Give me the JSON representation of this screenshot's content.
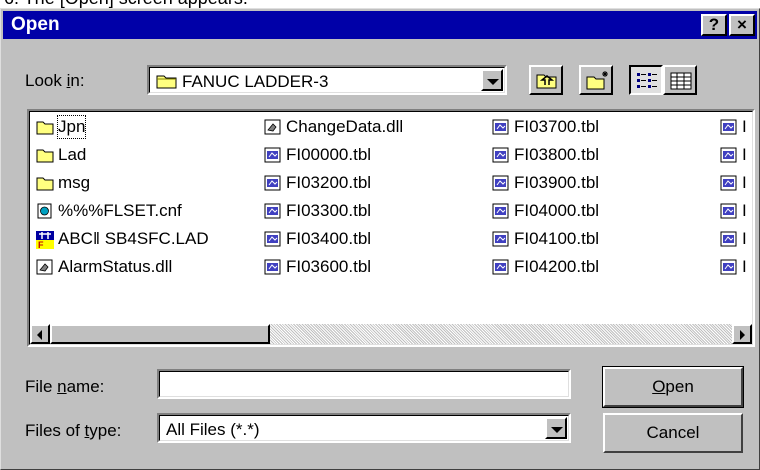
{
  "caption": "6. The [Open] screen appears.",
  "window": {
    "title": "Open",
    "help_glyph": "?",
    "close_glyph": "×"
  },
  "look_in": {
    "label_prefix": "Look ",
    "label_mnemonic": "i",
    "label_suffix": "n:",
    "value": "FANUC LADDER-3"
  },
  "toolbar": {
    "buttons": [
      {
        "name": "up-one-level",
        "icon": "up-folder-icon"
      },
      {
        "name": "create-new-folder",
        "icon": "new-folder-icon"
      },
      {
        "name": "list-view",
        "icon": "list-view-icon",
        "pressed": true
      },
      {
        "name": "details-view",
        "icon": "details-view-icon"
      }
    ]
  },
  "files": {
    "col1": [
      {
        "name": "Jpn",
        "type": "folder"
      },
      {
        "name": "Lad",
        "type": "folder"
      },
      {
        "name": "msg",
        "type": "folder"
      },
      {
        "name": "%%%FLSET.cnf",
        "type": "cnf"
      },
      {
        "name": "ABC‖ SB4SFC.LAD",
        "type": "lad"
      },
      {
        "name": "AlarmStatus.dll",
        "type": "dll"
      }
    ],
    "col2": [
      {
        "name": "ChangeData.dll",
        "type": "dll"
      },
      {
        "name": "FI00000.tbl",
        "type": "tbl"
      },
      {
        "name": "FI03200.tbl",
        "type": "tbl"
      },
      {
        "name": "FI03300.tbl",
        "type": "tbl"
      },
      {
        "name": "FI03400.tbl",
        "type": "tbl"
      },
      {
        "name": "FI03600.tbl",
        "type": "tbl"
      }
    ],
    "col3": [
      {
        "name": "FI03700.tbl",
        "type": "tbl"
      },
      {
        "name": "FI03800.tbl",
        "type": "tbl"
      },
      {
        "name": "FI03900.tbl",
        "type": "tbl"
      },
      {
        "name": "FI04000.tbl",
        "type": "tbl"
      },
      {
        "name": "FI04100.tbl",
        "type": "tbl"
      },
      {
        "name": "FI04200.tbl",
        "type": "tbl"
      }
    ],
    "col4": [
      {
        "name": "I",
        "type": "tbl"
      },
      {
        "name": "I",
        "type": "tbl"
      },
      {
        "name": "I",
        "type": "tbl"
      },
      {
        "name": "I",
        "type": "tbl"
      },
      {
        "name": "I",
        "type": "tbl"
      },
      {
        "name": "I",
        "type": "tbl"
      }
    ]
  },
  "file_name": {
    "label_prefix": "File ",
    "label_mnemonic": "n",
    "label_suffix": "ame:",
    "value": ""
  },
  "file_type": {
    "label_prefix": "Files of ",
    "label_mnemonic": "t",
    "label_suffix": "ype:",
    "value": "All Files (*.*)"
  },
  "buttons": {
    "open_mnemonic": "O",
    "open_rest": "pen",
    "cancel": "Cancel"
  },
  "colors": {
    "titlebar": "#0000a8",
    "face": "#c0c0c0",
    "folder": "#ffff80"
  }
}
